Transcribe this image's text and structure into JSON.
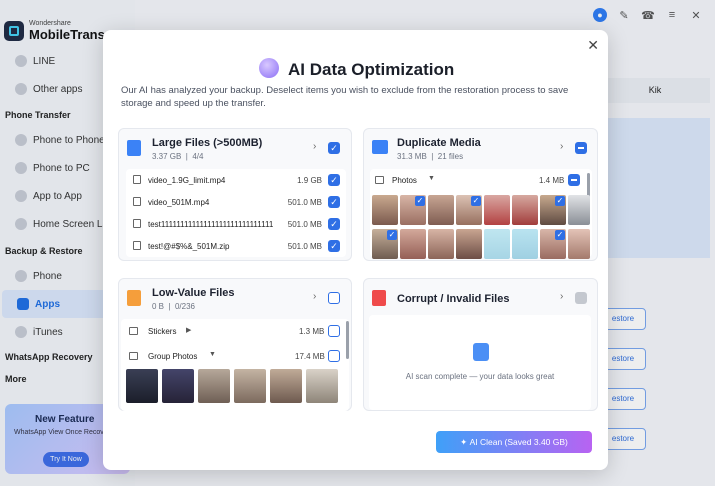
{
  "app": {
    "brand": "Wondershare",
    "name": "MobileTrans",
    "colors": {
      "accent": "#2f6fe5",
      "active_bg": "#dce8fc"
    }
  },
  "topbar": {
    "icons": [
      "user-icon",
      "edit-icon",
      "headset-icon",
      "menu-icon",
      "close-icon"
    ]
  },
  "sidebar": {
    "items_top": [
      {
        "label": "LINE"
      },
      {
        "label": "Other apps"
      }
    ],
    "section_phone_transfer": "Phone Transfer",
    "phone_transfer_items": [
      {
        "label": "Phone to Phone"
      },
      {
        "label": "Phone to PC"
      },
      {
        "label": "App to App"
      },
      {
        "label": "Home Screen Layout"
      }
    ],
    "section_backup": "Backup & Restore",
    "backup_items": [
      {
        "label": "Phone"
      },
      {
        "label": "Apps",
        "active": true
      },
      {
        "label": "iTunes"
      }
    ],
    "section_whatsapp": "WhatsApp Recovery",
    "section_more": "More",
    "promo": {
      "title": "New Feature",
      "subtitle": "WhatsApp View Once Recovery",
      "button": "Try It Now"
    }
  },
  "background": {
    "right_label": "Kik",
    "restore_label": "estore"
  },
  "modal": {
    "title": "AI Data Optimization",
    "description": "Our AI has analyzed your backup. Deselect items you wish to exclude from the restoration process to save storage and speed up the transfer.",
    "large_files": {
      "title": "Large Files (>500MB)",
      "size": "3.37 GB",
      "count": "4/4",
      "rows": [
        {
          "name": "video_1.9G_limit.mp4",
          "size": "1.9 GB"
        },
        {
          "name": "video_501M.mp4",
          "size": "501.0 MB"
        },
        {
          "name": "test11111111111111111111111111111",
          "size": "501.0 MB"
        },
        {
          "name": "test!@#$%&_501M.zip",
          "size": "501.0 MB"
        }
      ]
    },
    "duplicate_media": {
      "title": "Duplicate Media",
      "size": "31.3 MB",
      "count": "21 files",
      "group_label": "Photos",
      "group_size": "1.4 MB"
    },
    "low_value": {
      "title": "Low-Value Files",
      "size": "0 B",
      "count": "0/236",
      "groups": [
        {
          "label": "Stickers",
          "size": "1.3 MB"
        },
        {
          "label": "Group Photos",
          "size": "17.4 MB"
        }
      ]
    },
    "corrupt": {
      "title": "Corrupt / Invalid Files",
      "message": "AI scan complete — your data looks great"
    },
    "clean_button": "AI Clean (Saved 3.40 GB)"
  }
}
